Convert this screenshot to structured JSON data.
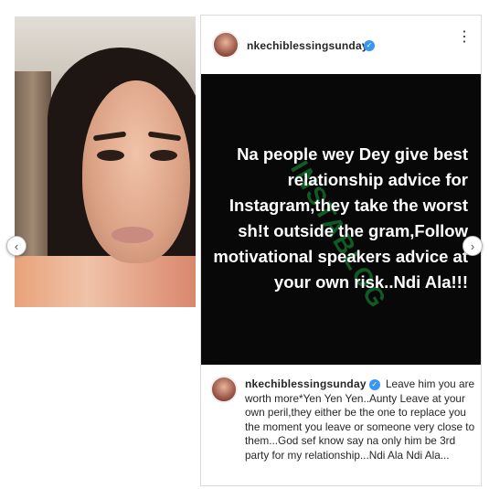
{
  "photo": {
    "prev_icon": "‹",
    "next_icon": "›"
  },
  "post": {
    "username": "nkechiblessingsunday",
    "verified_icon": "✓",
    "more_icon": "⋮",
    "image_text": "Na people wey Dey give best relationship advice for Instagram,they take the worst sh!t outside the gram,Follow motivational speakers advice at your own risk..Ndi Ala!!!",
    "comment": {
      "username": "nkechiblessingsunday",
      "text": "Leave him you are worth more*Yen Yen Yen..Aunty Leave at your own peril,they either be the one to replace you the moment you leave or someone very close to them...God sef know say na only him be 3rd party for my relationship...Ndi Ala Ndi Ala..."
    }
  }
}
